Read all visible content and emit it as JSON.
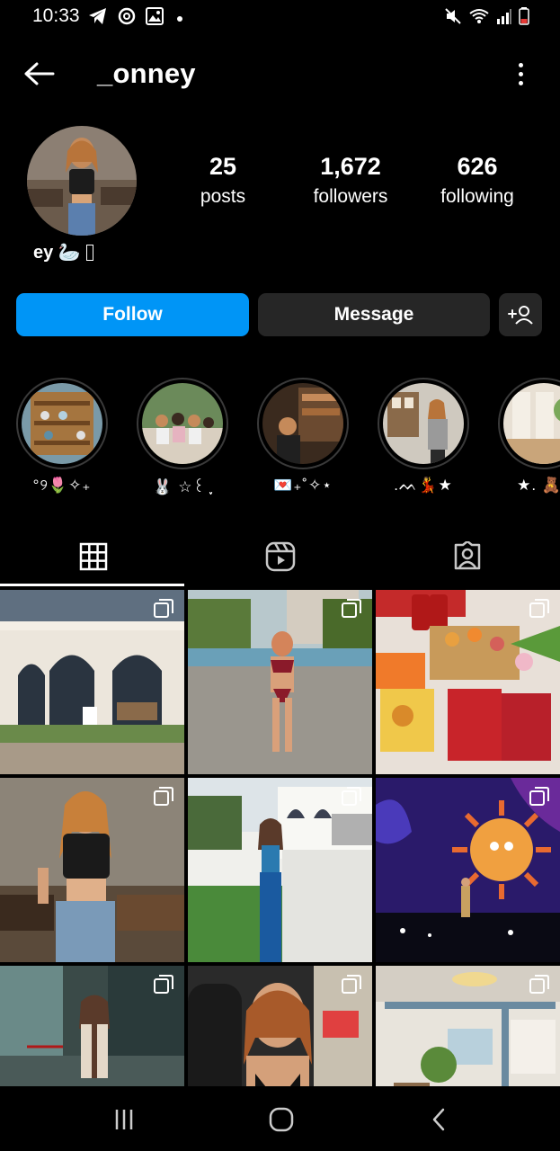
{
  "status_bar": {
    "time": "10:33",
    "left_icons": [
      "telegram-icon",
      "threads-icon",
      "gallery-icon",
      "dot-indicator"
    ],
    "right_icons": [
      "mute-icon",
      "wifi-icon",
      "signal-icon",
      "battery-low-icon"
    ]
  },
  "header": {
    "back_icon": "arrow-left-icon",
    "username": "_onney",
    "more_icon": "more-vertical-icon"
  },
  "profile": {
    "stats": [
      {
        "value": "25",
        "label": "posts"
      },
      {
        "value": "1,672",
        "label": "followers"
      },
      {
        "value": "626",
        "label": "following"
      }
    ],
    "bio_name": "ey 🦢",
    "bio_name_tail_glyph": "unknown-glyph"
  },
  "actions": {
    "follow_label": "Follow",
    "message_label": "Message",
    "add_user_icon": "add-person-icon"
  },
  "highlights": [
    {
      "label": "°୨🌷✧₊"
    },
    {
      "label": "🐰 ☆꒰ ִֶָ"
    },
    {
      "label": "💌₊˚✧⋆"
    },
    {
      "label": ".ᨓ💃★"
    },
    {
      "label": "★. 🧸₊"
    }
  ],
  "tabs": [
    {
      "name": "posts-grid",
      "icon": "grid-icon",
      "active": true
    },
    {
      "name": "reels",
      "icon": "reels-icon",
      "active": false
    },
    {
      "name": "tagged",
      "icon": "tagged-person-icon",
      "active": false
    }
  ],
  "grid_posts": [
    {
      "subject": "white cafe building with arched windows",
      "multiple": true
    },
    {
      "subject": "woman in red bikini by pool",
      "multiple": true
    },
    {
      "subject": "snacks and flowers on table",
      "multiple": true
    },
    {
      "subject": "woman in black vest and jeans in cafe",
      "multiple": true
    },
    {
      "subject": "woman in blue dress on lawn",
      "multiple": true
    },
    {
      "subject": "concert stage with sun backdrop",
      "multiple": true
    },
    {
      "subject": "woman with tie outside building",
      "multiple": true
    },
    {
      "subject": "woman in car selfie",
      "multiple": true
    },
    {
      "subject": "bright cafe interior",
      "multiple": true
    }
  ],
  "nav_bar": {
    "icons": [
      "recent-apps-icon",
      "home-icon",
      "back-icon"
    ]
  },
  "colors": {
    "background": "#000000",
    "accent": "#0095f6",
    "button_dark": "#262626"
  }
}
